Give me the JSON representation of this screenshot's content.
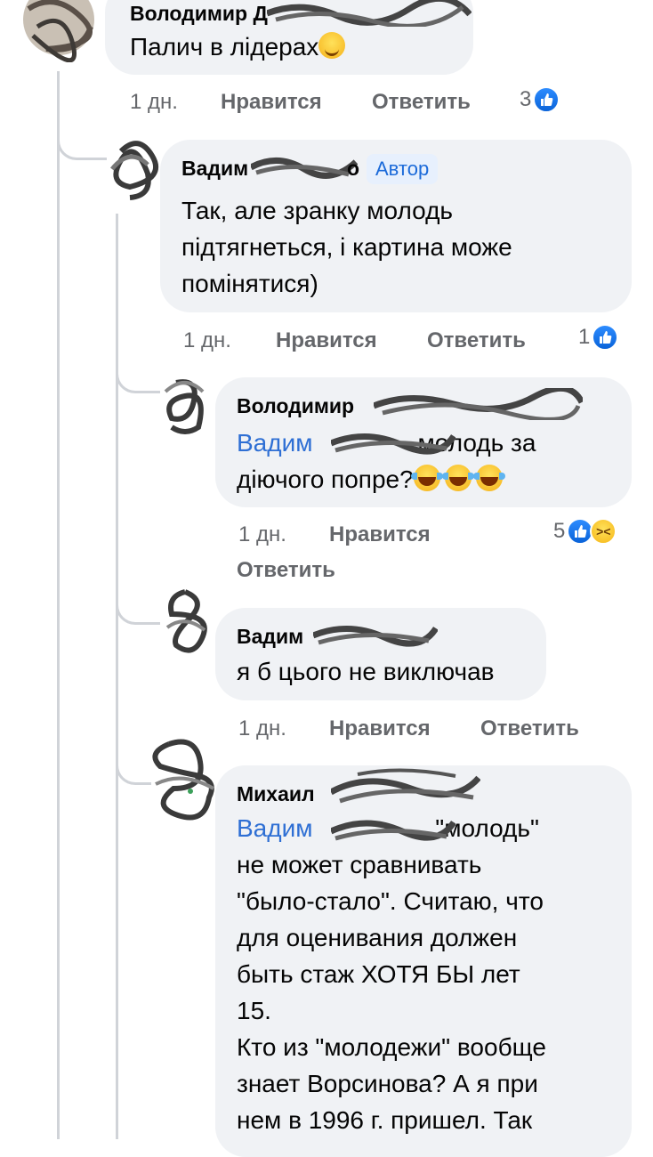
{
  "comments": [
    {
      "author": "Володимир Д",
      "text": "Палич в лідерах",
      "emoji": "winking-face",
      "time": "1 дн.",
      "like_label": "Нравится",
      "reply_label": "Ответить",
      "reaction_count": "3",
      "reactions": [
        "like"
      ]
    },
    {
      "author": "Вадим",
      "author_suffix": "о",
      "badge": "Автор",
      "text_lines": [
        "Так, але зранку молодь",
        "підтягнеться, і картина може",
        "помінятися)"
      ],
      "time": "1 дн.",
      "like_label": "Нравится",
      "reply_label": "Ответить",
      "reaction_count": "1",
      "reactions": [
        "like"
      ]
    },
    {
      "author": "Володимир",
      "mention": "Вадим",
      "text_after_mention": "молодь за",
      "text_line2": "діючого попре?",
      "emoji": "tears-of-joy x3",
      "time": "1 дн.",
      "like_label": "Нравится",
      "reply_label": "Ответить",
      "reaction_count": "5",
      "reactions": [
        "like",
        "haha"
      ]
    },
    {
      "author": "Вадим",
      "text": "я б цього не виключав",
      "time": "1 дн.",
      "like_label": "Нравится",
      "reply_label": "Ответить"
    },
    {
      "author": "Михаил",
      "mention": "Вадим",
      "text_after_mention": ",\"молодь\"",
      "text_lines": [
        "не может сравнивать",
        "\"было-стало\". Считаю, что",
        "для оценивания должен",
        "быть стаж ХОТЯ БЫ лет",
        "15.",
        "Кто из \"молодежи\" вообще",
        "знает Ворсинова? А я при",
        "нем в 1996 г. пришел. Так"
      ]
    }
  ],
  "colors": {
    "bubble": "#f0f2f5",
    "meta": "#65676b",
    "mention": "#2e6fd4",
    "like": "#1b74e4",
    "badge_bg": "#e7f0fd"
  }
}
